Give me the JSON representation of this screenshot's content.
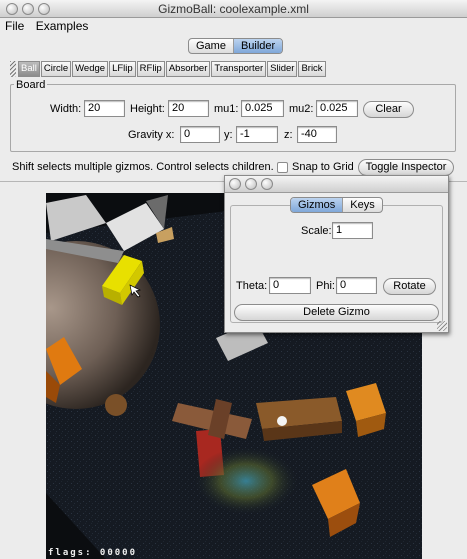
{
  "window": {
    "title": "GizmoBall: coolexample.xml"
  },
  "menu": [
    "File",
    "Examples"
  ],
  "mode_tabs": [
    {
      "label": "Game",
      "selected": false
    },
    {
      "label": "Builder",
      "selected": true
    }
  ],
  "gizmo_toolbar": [
    "Ball",
    "Circle",
    "Wedge",
    "LFlip",
    "RFlip",
    "Absorber",
    "Transporter",
    "Slider",
    "Brick"
  ],
  "board": {
    "legend": "Board",
    "width_label": "Width:",
    "width_value": "20",
    "height_label": "Height:",
    "height_value": "20",
    "mu1_label": "mu1:",
    "mu1_value": "0.025",
    "mu2_label": "mu2:",
    "mu2_value": "0.025",
    "clear_label": "Clear",
    "gravity_x_label": "Gravity x:",
    "gravity_x_value": "0",
    "gravity_y_label": "y:",
    "gravity_y_value": "-1",
    "gravity_z_label": "z:",
    "gravity_z_value": "-40"
  },
  "hint_text": "Shift selects multiple gizmos. Control selects children.",
  "snap_to_grid_label": "Snap to Grid",
  "toggle_inspector_label": "Toggle Inspector",
  "game_view": {
    "flags_text": "flags: 00000"
  },
  "inspector": {
    "tabs": [
      {
        "label": "Gizmos",
        "selected": true
      },
      {
        "label": "Keys",
        "selected": false
      }
    ],
    "scale_label": "Scale:",
    "scale_value": "1",
    "theta_label": "Theta:",
    "theta_value": "0",
    "phi_label": "Phi:",
    "phi_value": "0",
    "rotate_label": "Rotate",
    "delete_label": "Delete Gizmo"
  }
}
